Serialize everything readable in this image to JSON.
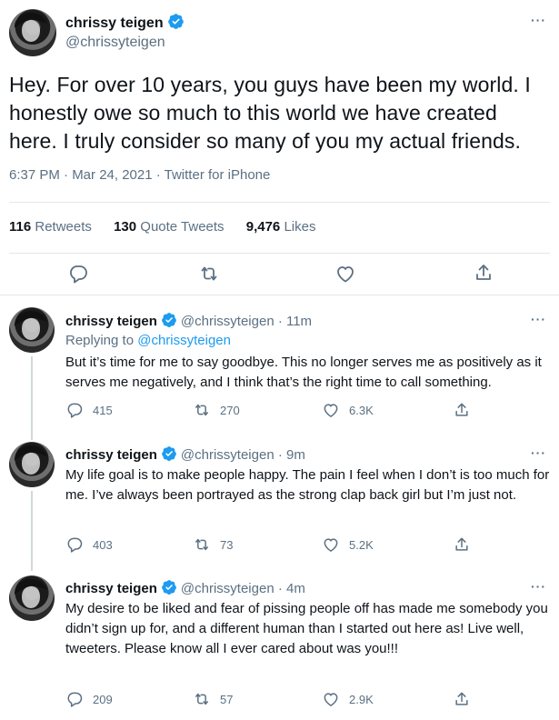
{
  "main_tweet": {
    "display_name": "chrissy teigen",
    "handle": "@chrissyteigen",
    "text": "Hey. For over 10 years, you guys have been my world. I honestly owe so much to this world we have created here. I truly consider so many of you my actual friends.",
    "timestamp": "6:37 PM · Mar 24, 2021 · Twitter for iPhone",
    "retweets": "116",
    "retweets_label": "Retweets",
    "quote_tweets": "130",
    "quote_tweets_label": "Quote Tweets",
    "likes": "9,476",
    "likes_label": "Likes"
  },
  "replies": [
    {
      "display_name": "chrissy teigen",
      "handle": "@chrissyteigen · 11m",
      "replying_prefix": "Replying to",
      "replying_to": "@chrissyteigen",
      "text": "But it’s time for me to say goodbye. This no longer serves me as positively as it serves me negatively, and I think that’s the right time to call something.",
      "reply_count": "415",
      "retweet_count": "270",
      "like_count": "6.3K"
    },
    {
      "display_name": "chrissy teigen",
      "handle": "@chrissyteigen · 9m",
      "text": "My life goal is to make people happy. The pain I feel when I don’t is too much for me. I’ve always been portrayed as the strong clap back girl but I’m just not.",
      "reply_count": "403",
      "retweet_count": "73",
      "like_count": "5.2K"
    },
    {
      "display_name": "chrissy teigen",
      "handle": "@chrissyteigen · 4m",
      "text": "My desire to be liked and fear of pissing people off has made me somebody you didn’t sign up for, and a different human than I started out here as! Live well, tweeters. Please know all I ever cared about was you!!!",
      "reply_count": "209",
      "retweet_count": "57",
      "like_count": "2.9K"
    }
  ],
  "more_label": "···",
  "colors": {
    "verified": "#1d9bf0",
    "muted": "#5b7083",
    "link": "#1d9bf0",
    "text": "#0f1419"
  },
  "icons": [
    "verified-badge-icon",
    "reply-icon",
    "retweet-icon",
    "like-icon",
    "share-icon",
    "more-icon"
  ]
}
